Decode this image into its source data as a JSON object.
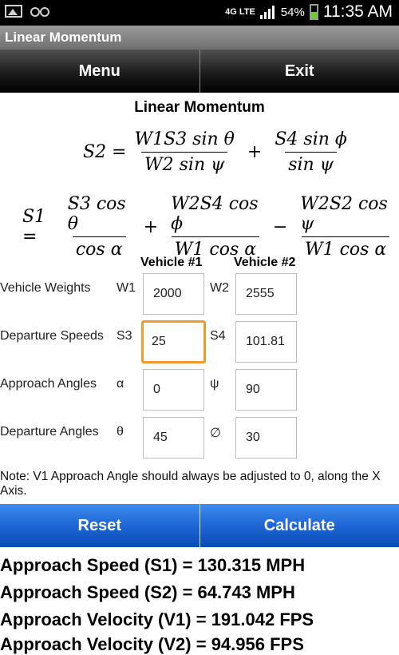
{
  "status_bar": {
    "network": "4G LTE",
    "battery": "54%",
    "time": "11:35 AM"
  },
  "app": {
    "title": "Linear Momentum"
  },
  "nav": {
    "menu": "Menu",
    "exit": "Exit"
  },
  "heading": "Linear Momentum",
  "equations": {
    "eq1": {
      "lhs": "S2 =",
      "t1_num": "W1S3 sin θ",
      "t1_den": "W2 sin ψ",
      "op1": "+",
      "t2_num": "S4 sin ϕ",
      "t2_den": "sin ψ"
    },
    "eq2": {
      "lhs": "S1 =",
      "t1_num": "S3 cos θ",
      "t1_den": "cos α",
      "op1": "+",
      "t2_num": "W2S4 cos ϕ",
      "t2_den": "W1 cos α",
      "op2": "−",
      "t3_num": "W2S2 cos ψ",
      "t3_den": "W1 cos α"
    }
  },
  "columns": {
    "v1": "Vehicle #1",
    "v2": "Vehicle #2"
  },
  "rows": [
    {
      "label": "Vehicle Weights",
      "sym1": "W1",
      "val1": "2000",
      "sym2": "W2",
      "val2": "2555"
    },
    {
      "label": "Departure Speeds",
      "sym1": "S3",
      "val1": "25",
      "sym2": "S4",
      "val2": "101.81"
    },
    {
      "label": "Approach Angles",
      "sym1": "α",
      "val1": "0",
      "sym2": "ψ",
      "val2": "90"
    },
    {
      "label": "Departure Angles",
      "sym1": "θ",
      "val1": "45",
      "sym2": "∅",
      "val2": "30"
    }
  ],
  "note": "Note: V1 Approach Angle should always be adjusted to 0, along the X Axis.",
  "buttons": {
    "reset": "Reset",
    "calculate": "Calculate"
  },
  "results": [
    "Approach Speed (S1) = 130.315 MPH",
    "Approach Speed (S2) = 64.743 MPH",
    "Approach Velocity (V1) = 191.042 FPS",
    "Approach Velocity (V2) = 94.956 FPS"
  ],
  "colors": {
    "focus": "#f19a2b",
    "button_blue": "#1e66d6"
  }
}
